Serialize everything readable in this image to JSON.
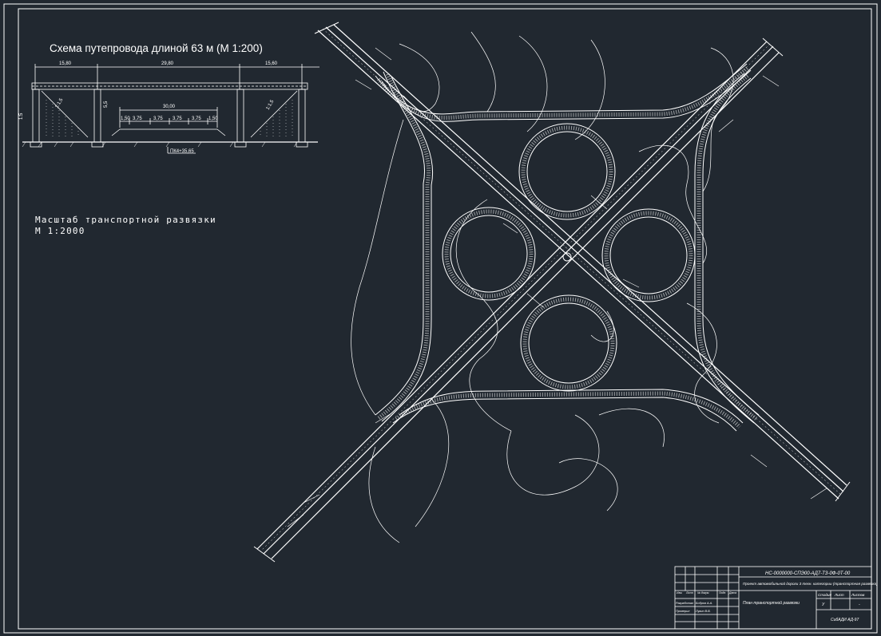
{
  "drawing": {
    "background": "#212830",
    "line_color": "#ffffff"
  },
  "bridge_scheme": {
    "title": "Схема путепровода длиной 63 м (М 1:200)",
    "span_left": "15,80",
    "span_mid": "29,80",
    "span_right": "15,60",
    "inner_width": "30,00",
    "lanes": [
      "1,50",
      "3,75",
      "3,75",
      "3,75",
      "3,75",
      "1,50"
    ],
    "height_left": "1:5",
    "height_mid": "5,5",
    "slope_left": "1:1,5",
    "slope_right": "1:1,5",
    "picket": "ПК4+35,65"
  },
  "interchange": {
    "scale_label": "Масштаб транспортной развязки",
    "scale_value": "М 1:2000"
  },
  "title_block": {
    "code": "НС-0000000-СПЭ00-АД7-ТЗ-0Ф-0Т-00",
    "project_title": "Проект автомобильной дороги 3 техн. категории (транспортная развязка)",
    "sheet_name": "План транспортной развязки",
    "col_stage": "Стадия",
    "col_sheet": "Лист",
    "col_sheets": "Листов",
    "stage_value": "У",
    "sheet_value": "",
    "sheets_value": "-",
    "org": "СибАДИ АД-97",
    "head_cols": [
      "Изм.",
      "Лист",
      "№ докум.",
      "Подп.",
      "Дата"
    ],
    "roles": [
      "Разработал",
      "Проверил"
    ],
    "names": [
      "Бобров А.А.",
      "Лукин В.В."
    ]
  }
}
